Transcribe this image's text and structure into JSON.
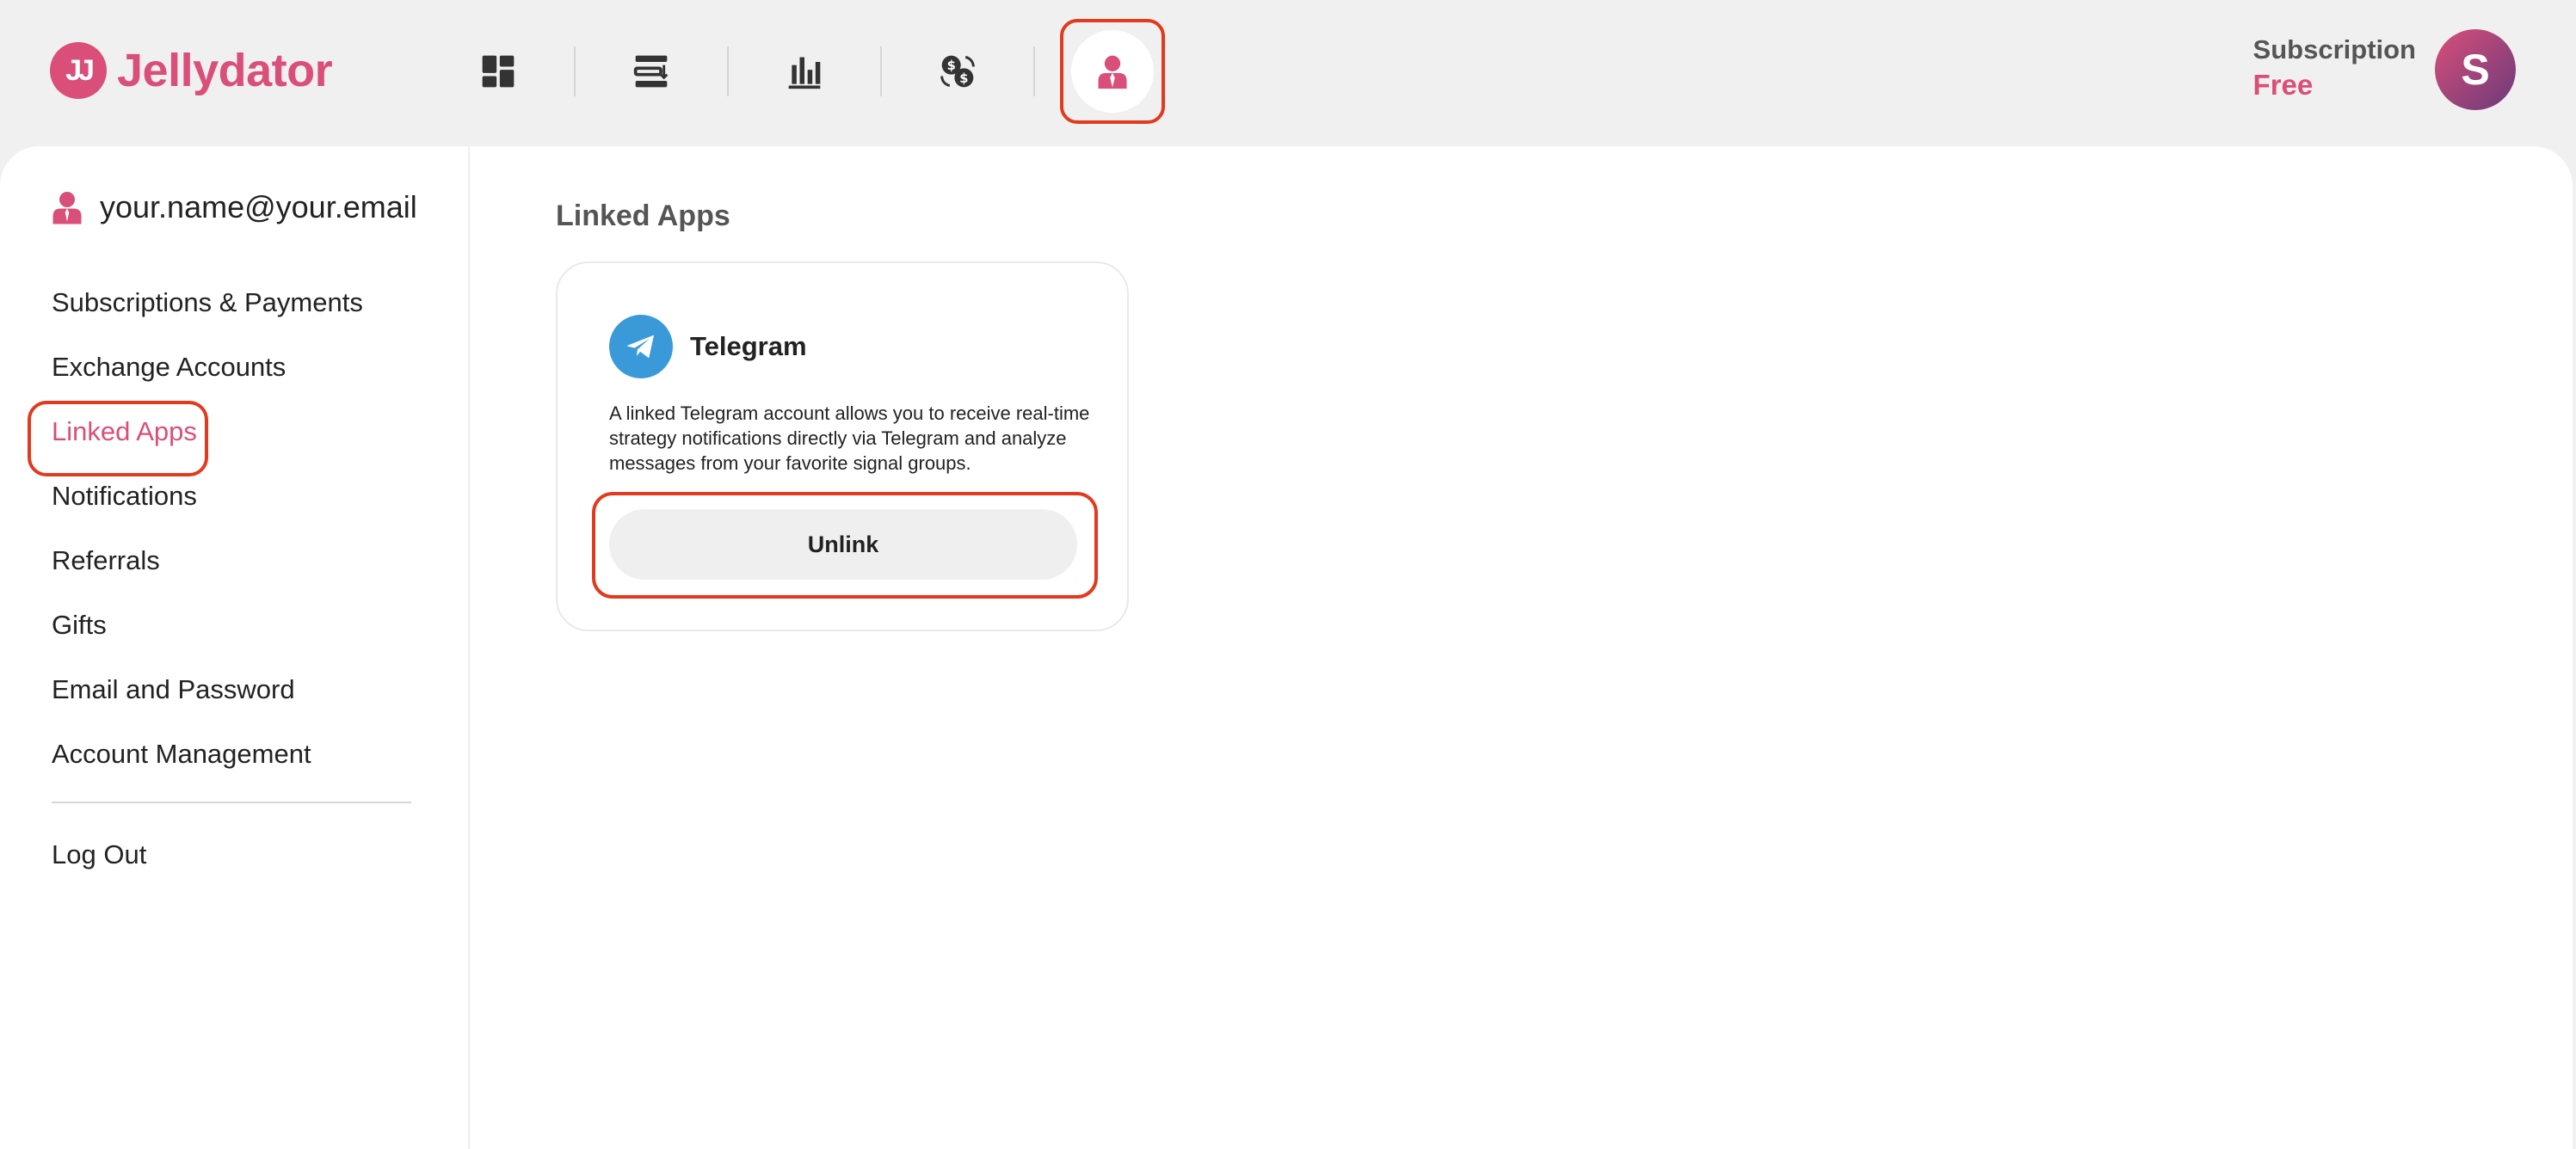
{
  "app": {
    "logo_mark": "JJ",
    "brand": "Jellydator",
    "accent_color": "#d94f7a",
    "highlight_color": "#e23a1e"
  },
  "nav": {
    "items": [
      {
        "icon": "dashboard-icon",
        "active": false
      },
      {
        "icon": "strategy-list-icon",
        "active": false
      },
      {
        "icon": "bar-chart-icon",
        "active": false
      },
      {
        "icon": "currency-exchange-icon",
        "active": false
      },
      {
        "icon": "user-profile-icon",
        "active": true
      }
    ]
  },
  "subscription": {
    "label": "Subscription",
    "value": "Free"
  },
  "avatar": {
    "initial": "S"
  },
  "sidebar": {
    "email": "your.name@your.email",
    "items": [
      {
        "label": "Subscriptions & Payments",
        "active": false
      },
      {
        "label": "Exchange Accounts",
        "active": false
      },
      {
        "label": "Linked Apps",
        "active": true
      },
      {
        "label": "Notifications",
        "active": false
      },
      {
        "label": "Referrals",
        "active": false
      },
      {
        "label": "Gifts",
        "active": false
      },
      {
        "label": "Email and Password",
        "active": false
      },
      {
        "label": "Account Management",
        "active": false
      }
    ],
    "logout": "Log Out"
  },
  "main": {
    "title": "Linked Apps",
    "card": {
      "name": "Telegram",
      "description": "A linked Telegram account allows you to receive real-time strategy notifications directly via Telegram and analyze messages from your favorite signal groups.",
      "button": "Unlink"
    }
  }
}
